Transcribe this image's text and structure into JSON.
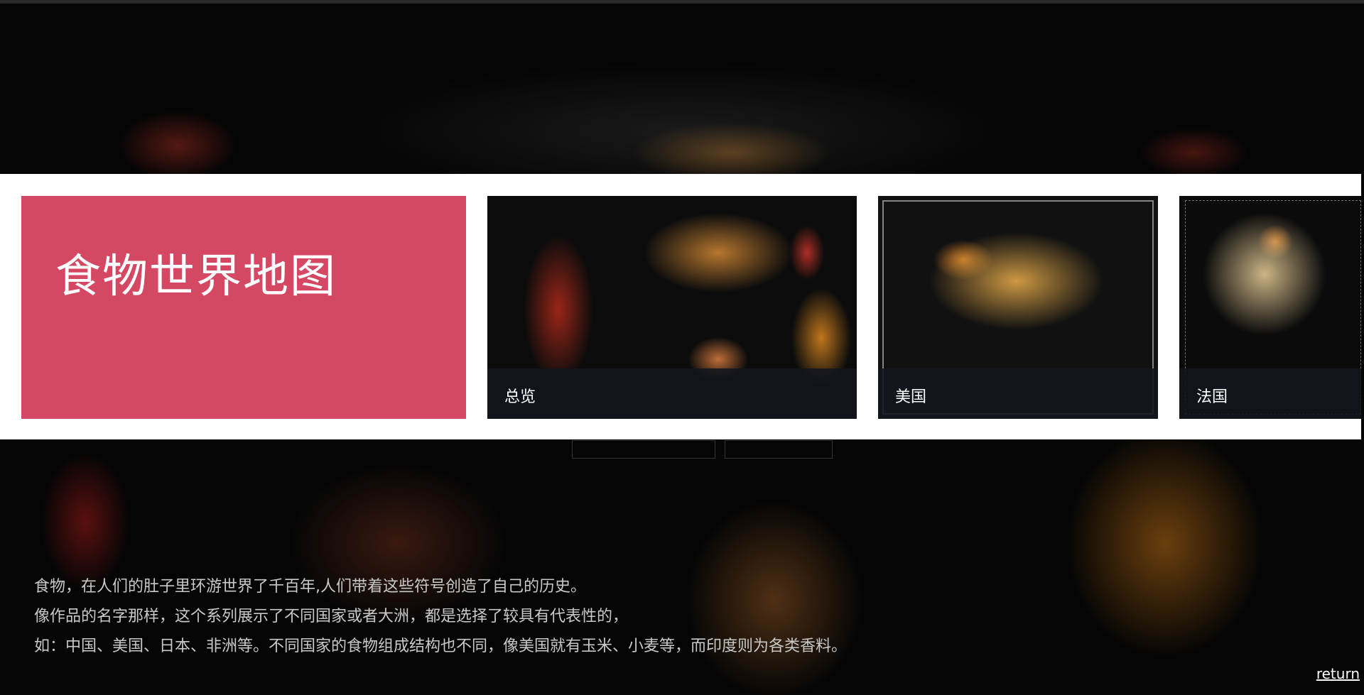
{
  "page": {
    "title": "食物世界地图"
  },
  "gallery": {
    "items": [
      {
        "label": "总览"
      },
      {
        "label": "美国"
      },
      {
        "label": "法国"
      }
    ]
  },
  "description": {
    "lines": [
      "食物，在人们的肚子里环游世界了千百年,人们带着这些符号创造了自己的历史。",
      "像作品的名字那样，这个系列展示了不同国家或者大洲，都是选择了较具有代表性的，",
      "如：中国、美国、日本、非洲等。不同国家的食物组成结构也不同，像美国就有玉米、小麦等，而印度则为各类香料。"
    ]
  },
  "nav": {
    "return_label": "return"
  },
  "colors": {
    "title_tile": "#d44863",
    "band": "#ffffff",
    "background": "#000000",
    "caption_bar": "#12161e"
  }
}
